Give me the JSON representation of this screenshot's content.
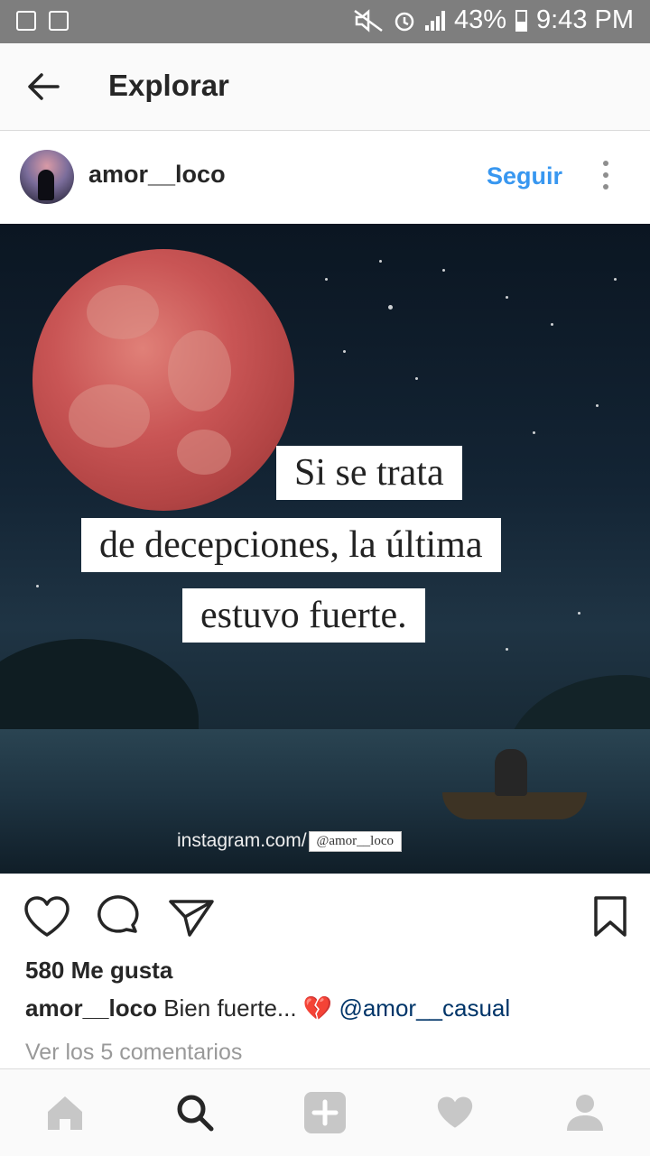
{
  "status_bar": {
    "battery": "43%",
    "time": "9:43 PM",
    "icons": [
      "gallery-icon",
      "recycle-icon",
      "mute-icon",
      "alarm-icon",
      "signal-icon",
      "battery-icon"
    ]
  },
  "header": {
    "title": "Explorar",
    "back_icon": "arrow-left-icon"
  },
  "post": {
    "username": "amor__loco",
    "follow_label": "Seguir",
    "more_icon": "more-vertical-icon",
    "image": {
      "quote_lines": [
        "Si se trata",
        "de decepciones, la última",
        "estuvo fuerte."
      ],
      "watermark_prefix": "instagram.com/",
      "watermark_handle": "@amor__loco"
    },
    "likes": "580 Me gusta",
    "caption_user": "amor__loco",
    "caption_text": "Bien fuerte...",
    "caption_emoji": "💔",
    "caption_mention": "@amor__casual",
    "view_comments": "Ver los 5 comentarios"
  },
  "actions": [
    "heart-icon",
    "comment-icon",
    "share-icon",
    "bookmark-icon"
  ],
  "bottom_nav": [
    "home-icon",
    "search-icon",
    "add-icon",
    "activity-icon",
    "profile-icon"
  ],
  "colors": {
    "accent": "#3897f0",
    "status_bar": "#7e7e7e",
    "text": "#262626",
    "muted": "#999999",
    "mention": "#003569"
  }
}
